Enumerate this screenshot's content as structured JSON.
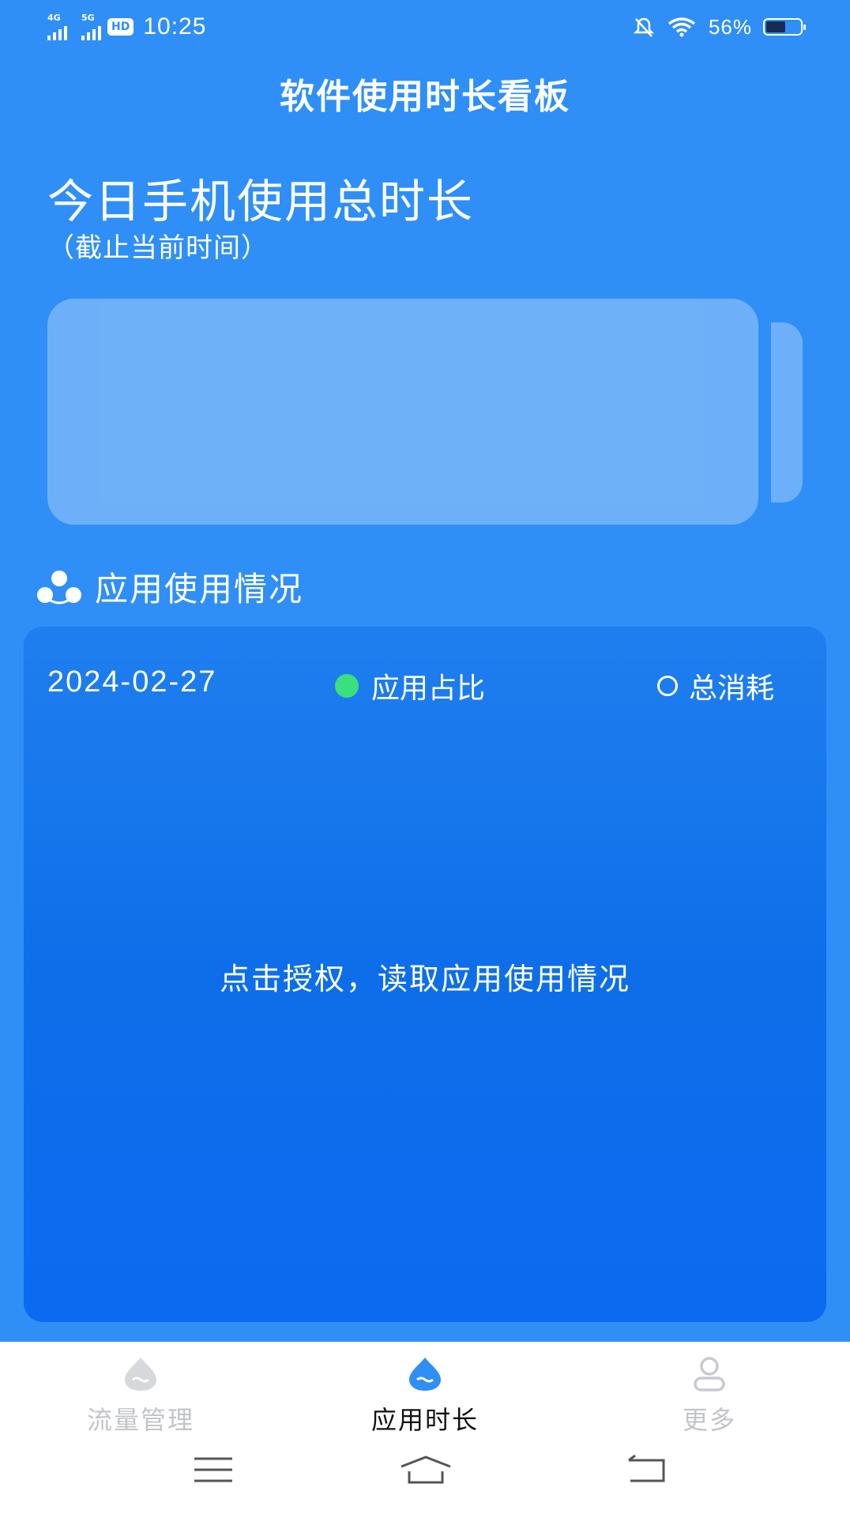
{
  "status_bar": {
    "net1": "4G",
    "net2": "5G",
    "hd": "HD",
    "time": "10:25",
    "battery_pct": "56%",
    "battery_level": 0.56,
    "icons": [
      "signal-icon",
      "signal-icon",
      "hd-icon",
      "mute-icon",
      "wifi-icon",
      "battery-icon"
    ]
  },
  "header": {
    "title": "软件使用时长看板"
  },
  "today": {
    "title": "今日手机使用总时长",
    "subtitle": "（截止当前时间）"
  },
  "section": {
    "icon": "people-group-icon",
    "title": "应用使用情况"
  },
  "card": {
    "date": "2024-02-27",
    "legend_share": "应用占比",
    "legend_total": "总消耗",
    "authorize_text": "点击授权，读取应用使用情况"
  },
  "bottom_nav": {
    "items": [
      {
        "label": "流量管理",
        "icon": "drop-icon",
        "active": false
      },
      {
        "label": "应用时长",
        "icon": "drop-icon",
        "active": true
      },
      {
        "label": "更多",
        "icon": "person-icon",
        "active": false
      }
    ]
  },
  "system_nav": {
    "icons": [
      "menu-icon",
      "home-icon",
      "back-icon"
    ]
  },
  "colors": {
    "background": "#2f8ff7",
    "card": "#0e6ee9",
    "accent_green": "#39e07c",
    "active_icon": "#2f8ff7",
    "inactive": "#c2c4c8"
  }
}
